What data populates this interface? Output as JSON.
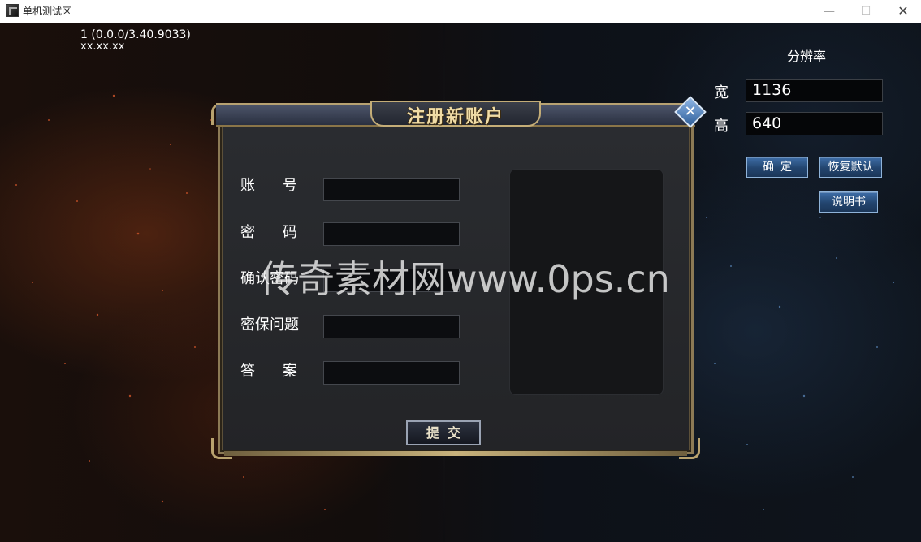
{
  "window": {
    "title": "单机测试区",
    "controls": {
      "minimize": "—",
      "maximize": "☐",
      "close": "✕"
    }
  },
  "client": {
    "version": "1 (0.0.0/3.40.9033)",
    "ip": "xx.xx.xx"
  },
  "resolution": {
    "title": "分辨率",
    "width_label": "宽",
    "width_value": "1136",
    "height_label": "高",
    "height_value": "640",
    "confirm_label": "确定",
    "restore_label": "恢复默认",
    "manual_label": "说明书"
  },
  "register_dialog": {
    "title": "注册新账户",
    "close_glyph": "✕",
    "fields": [
      {
        "label": "账号",
        "value": ""
      },
      {
        "label": "密码",
        "value": ""
      },
      {
        "label": "确认密码",
        "value": ""
      },
      {
        "label": "密保问题",
        "value": ""
      },
      {
        "label": "答案",
        "value": ""
      }
    ],
    "submit_label": "提交"
  },
  "watermark": "传奇素材网www.0ps.cn",
  "colors": {
    "title_gold": "#f0dca6",
    "frame_gold": "#8c7a55",
    "button_blue": "#23456f"
  }
}
